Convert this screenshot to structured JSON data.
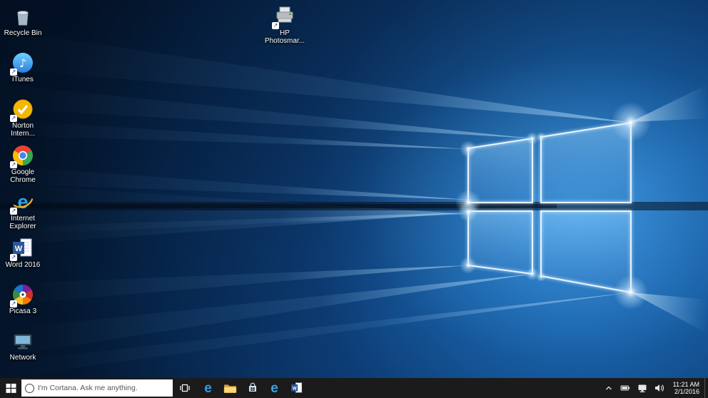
{
  "desktop": {
    "icons": [
      {
        "label": "Recycle Bin",
        "icon": "recycle-bin-icon",
        "shortcut": false
      },
      {
        "label": "iTunes",
        "icon": "itunes-icon",
        "shortcut": true
      },
      {
        "label": "Norton Intern...",
        "icon": "norton-icon",
        "shortcut": true
      },
      {
        "label": "Google Chrome",
        "icon": "chrome-icon",
        "shortcut": true
      },
      {
        "label": "Internet Explorer",
        "icon": "internet-explorer-icon",
        "shortcut": true
      },
      {
        "label": "Word 2016",
        "icon": "word-icon",
        "shortcut": true
      },
      {
        "label": "Picasa 3",
        "icon": "picasa-icon",
        "shortcut": true
      },
      {
        "label": "Network",
        "icon": "network-icon",
        "shortcut": false
      },
      {
        "label": "HP Photosmar...",
        "icon": "printer-icon",
        "shortcut": true
      }
    ]
  },
  "taskbar": {
    "search": {
      "placeholder": "I'm Cortana. Ask me anything.",
      "icon": "cortana-circle-icon"
    },
    "buttons": [
      "start",
      "task-view",
      "edge",
      "file-explorer",
      "store",
      "internet-explorer",
      "word"
    ],
    "tray": {
      "icons": [
        "hidden-icons-chevron",
        "battery",
        "network",
        "volume"
      ],
      "time": "11:21 AM",
      "date": "2/1/2016"
    }
  },
  "colors": {
    "taskbar_bg": "#1b1b1b",
    "wallpaper_accent": "#2e86d4",
    "office_word_blue": "#2b579a",
    "edge_blue": "#2f9ce6"
  }
}
